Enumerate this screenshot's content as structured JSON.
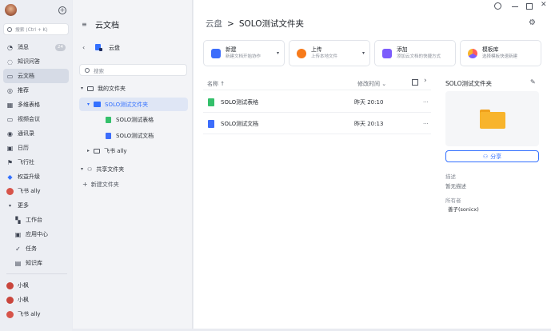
{
  "nav": {
    "search_label": "搜索 (Ctrl + K)",
    "items": [
      {
        "label": "消息",
        "badge": "24"
      },
      {
        "label": "知识问答"
      },
      {
        "label": "云文档"
      },
      {
        "label": "推荐"
      },
      {
        "label": "多维表格"
      },
      {
        "label": "视频会议"
      },
      {
        "label": "通讯录"
      },
      {
        "label": "日历"
      },
      {
        "label": "飞行社"
      },
      {
        "label": "权益升级"
      },
      {
        "label": "飞书 ally"
      },
      {
        "label": "更多"
      }
    ],
    "more_items": [
      {
        "label": "工作台"
      },
      {
        "label": "应用中心"
      },
      {
        "label": "任务"
      },
      {
        "label": "知识库"
      }
    ],
    "contacts": [
      {
        "label": "小枫"
      },
      {
        "label": "小枫"
      },
      {
        "label": "飞书 ally"
      }
    ]
  },
  "tree": {
    "title": "云文档",
    "drive_label": "云盘",
    "search_label": "搜索",
    "my_folder": "我的文件夹",
    "solo_folder": "SOLO测试文件夹",
    "sheet": "SOLO测试表格",
    "doc": "SOLO测试文档",
    "feishu_ally": "飞书 ally",
    "shared": "共享文件夹",
    "new_folder": "新建文件夹"
  },
  "main": {
    "breadcrumb_root": "云盘",
    "breadcrumb_sep": ">",
    "breadcrumb_current": "SOLO测试文件夹",
    "cards": [
      {
        "title": "新建",
        "sub": "新建文档开始协作"
      },
      {
        "title": "上传",
        "sub": "上传本地文件"
      },
      {
        "title": "添加",
        "sub": "添加云文档的快捷方式"
      },
      {
        "title": "模板库",
        "sub": "选择模板快速新建"
      }
    ],
    "col_name": "名称 ↑",
    "col_modified": "修改时间 ⌄",
    "files": [
      {
        "name": "SOLO测试表格",
        "time": "昨天 20:10",
        "more": "···"
      },
      {
        "name": "SOLO测试文档",
        "time": "昨天 20:13",
        "more": "···"
      }
    ]
  },
  "detail": {
    "title": "SOLO测试文件夹",
    "share_label": "分享",
    "desc_label": "描述",
    "desc_value": "暂无描述",
    "owner_label": "所有者",
    "owner_value": "善子(sonicx)"
  },
  "colors": {
    "accent": "#3370ff",
    "sheet_green": "#34c06b",
    "doc_blue": "#3c6dfb",
    "folder_yellow": "#f8b42c",
    "upload_orange": "#f77a1a",
    "add_purple": "#7c5cfc"
  }
}
